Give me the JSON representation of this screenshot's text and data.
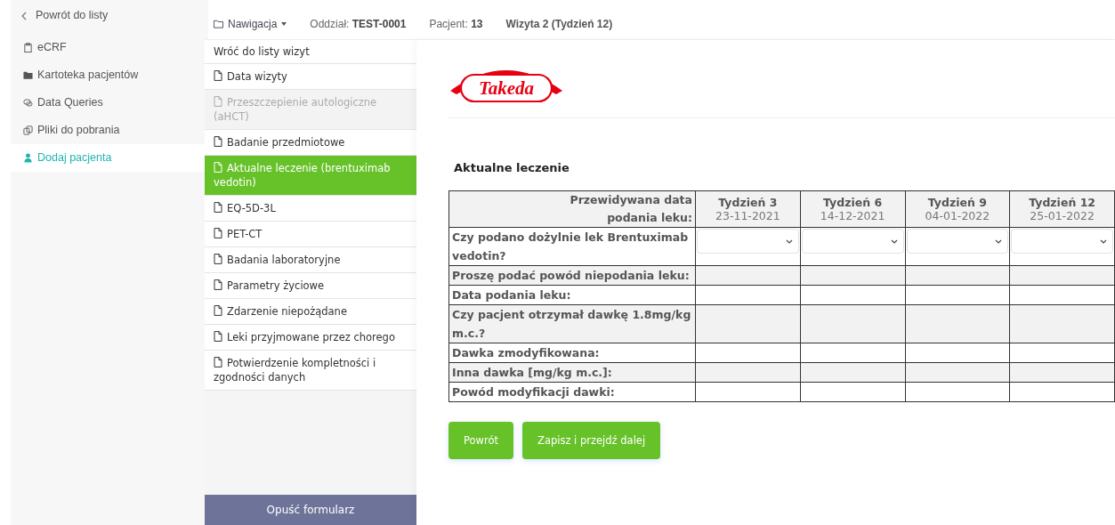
{
  "sidebar": {
    "back": "Powrót do listy",
    "items": [
      {
        "label": "eCRF",
        "selected": false
      },
      {
        "label": "Kartoteka pacjentów",
        "selected": false
      },
      {
        "label": "Data Queries",
        "selected": false
      },
      {
        "label": "Pliki do pobrania",
        "selected": false
      },
      {
        "label": "Dodaj pacjenta",
        "selected": true
      }
    ]
  },
  "topbar": {
    "nav": "Nawigacja",
    "fields": [
      {
        "label": "Oddział:",
        "value": "TEST-0001"
      },
      {
        "label": "Pacjent:",
        "value": "13"
      }
    ],
    "visit": "Wizyta 2 (Tydzień 12)"
  },
  "form_menu": {
    "back": "Wróć do listy wizyt",
    "items": [
      {
        "label": "Data wizyty",
        "selected": false,
        "disabled": false
      },
      {
        "label": "Przeszczepienie autologiczne (aHCT)",
        "selected": false,
        "disabled": true
      },
      {
        "label": "Badanie przedmiotowe",
        "selected": false,
        "disabled": false
      },
      {
        "label": "Aktualne leczenie (brentuximab vedotin)",
        "selected": true,
        "disabled": false
      },
      {
        "label": "EQ-5D-3L",
        "selected": false,
        "disabled": false
      },
      {
        "label": "PET-CT",
        "selected": false,
        "disabled": false
      },
      {
        "label": "Badania laboratoryjne",
        "selected": false,
        "disabled": false
      },
      {
        "label": "Parametry życiowe",
        "selected": false,
        "disabled": false
      },
      {
        "label": "Zdarzenie niepożądane",
        "selected": false,
        "disabled": false
      },
      {
        "label": "Leki przyjmowane przez chorego",
        "selected": false,
        "disabled": false
      },
      {
        "label": "Potwierdzenie kompletności i zgodności danych",
        "selected": false,
        "disabled": false
      }
    ],
    "leave": "Opuść formularz"
  },
  "logo": "Takeda",
  "section_title": "Aktualne leczenie",
  "table": {
    "corner": "Przewidywana data podania leku:",
    "columns": [
      {
        "week": "Tydzień 3",
        "date": "23-11-2021"
      },
      {
        "week": "Tydzień 6",
        "date": "14-12-2021"
      },
      {
        "week": "Tydzień 9",
        "date": "04-01-2022"
      },
      {
        "week": "Tydzień 12",
        "date": "25-01-2022"
      }
    ],
    "rows": [
      {
        "label": "Czy podano dożylnie lek Brentuximab vedotin?",
        "kind": "select"
      },
      {
        "label": "Proszę podać powód niepodania leku:",
        "kind": "empty"
      },
      {
        "label": "Data podania leku:",
        "kind": "empty"
      },
      {
        "label": "Czy pacjent otrzymał dawkę 1.8mg/kg m.c.?",
        "kind": "empty"
      },
      {
        "label": "Dawka zmodyfikowana:",
        "kind": "empty"
      },
      {
        "label": "Inna dawka [mg/kg m.c.]:",
        "kind": "empty"
      },
      {
        "label": "Powód modyfikacji dawki:",
        "kind": "empty"
      }
    ]
  },
  "buttons": [
    "Powrót",
    "Zapisz i przejdź dalej"
  ]
}
